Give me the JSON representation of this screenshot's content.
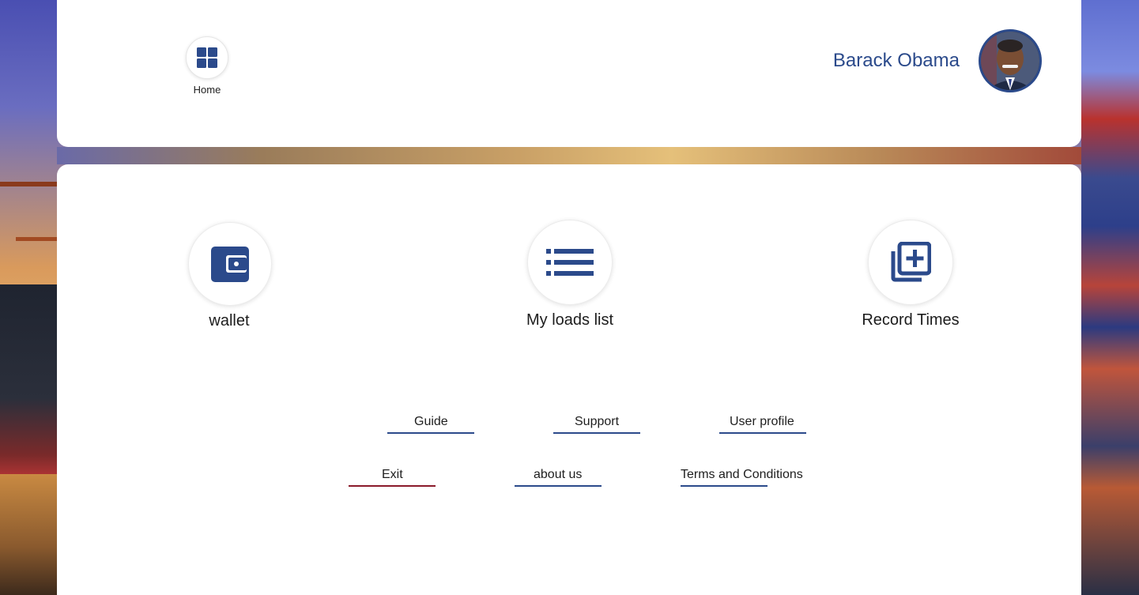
{
  "header": {
    "home_label": "Home",
    "user_name": "Barack Obama"
  },
  "tiles": [
    {
      "label": "wallet",
      "icon": "wallet-icon"
    },
    {
      "label": "My loads list",
      "icon": "list-icon"
    },
    {
      "label": "Record Times",
      "icon": "add-record-icon"
    }
  ],
  "links": {
    "guide": "Guide",
    "support": "Support",
    "user_profile": "User profile",
    "exit": "Exit",
    "about_us": "about us",
    "terms": "Terms and Conditions"
  },
  "colors": {
    "accent": "#2b4a8b",
    "exit_underline": "#8a1a2a"
  }
}
